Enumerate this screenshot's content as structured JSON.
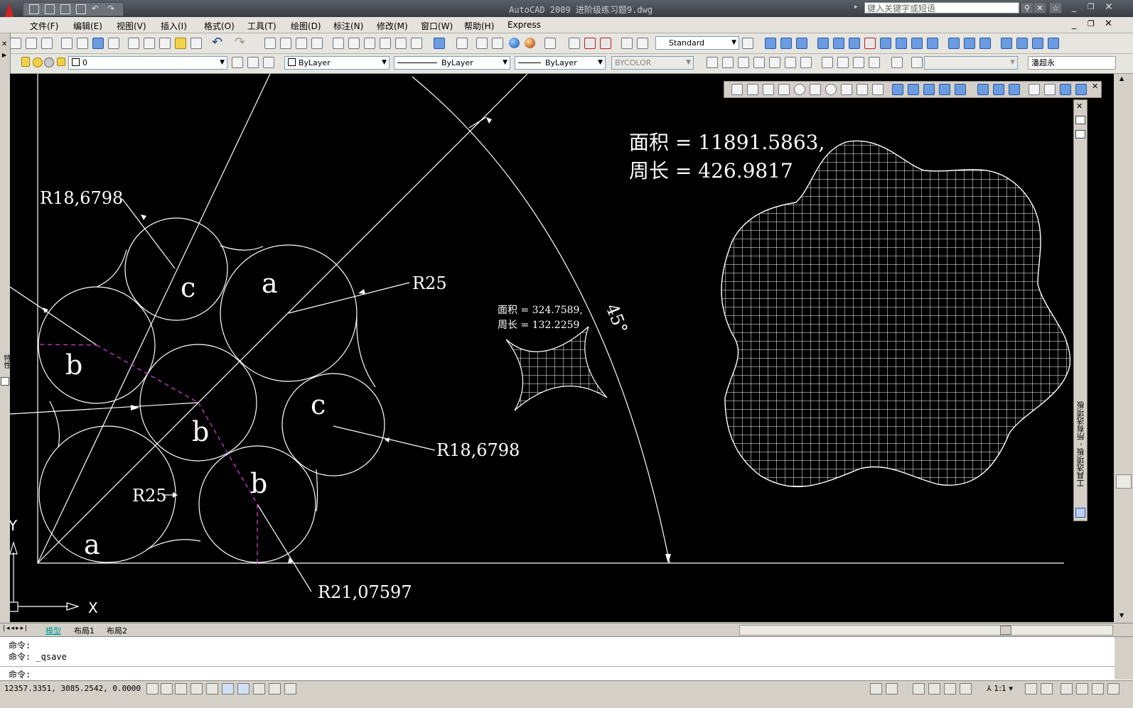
{
  "window": {
    "title": "AutoCAD 2009  进阶级练习题9.dwg",
    "search_placeholder": "键入关键字或短语"
  },
  "menu": [
    "文件(F)",
    "编辑(E)",
    "视图(V)",
    "插入(I)",
    "格式(O)",
    "工具(T)",
    "绘图(D)",
    "标注(N)",
    "修改(M)",
    "窗口(W)",
    "帮助(H)",
    "Express"
  ],
  "toolbar": {
    "text_style": "Standard",
    "layer_name": "0",
    "color": "ByLayer",
    "linetype": "ByLayer",
    "lineweight": "ByLayer",
    "plot_style": "BYCOLOR",
    "user_field": "潘超永"
  },
  "palette": {
    "side_label": "工具选项板 - 所有选项板",
    "left_tab_label": "特性"
  },
  "drawing": {
    "labels": {
      "a": "a",
      "b": "b",
      "c": "c"
    },
    "dim_r18_top": "R18,6798",
    "dim_r25_right": "R25",
    "dim_r18_right": "R18,6798",
    "dim_r25_left": "R25",
    "dim_r21": "R21,07597",
    "angle": "45°",
    "small_area": "面积 = 324.7589,",
    "small_perimeter": "周长 = 132.2259",
    "big_area": "面积 = 11891.5863,",
    "big_perimeter": "周长 = 426.9817",
    "ucs_x": "X",
    "ucs_y": "Y"
  },
  "tabs": [
    "模型",
    "布局1",
    "布局2"
  ],
  "command": {
    "line1": "命令:",
    "line2": "命令: _qsave",
    "prompt": "命令:"
  },
  "status": {
    "coords": "12357.3351, 3085.2542, 0.0000",
    "scale": "1:1"
  },
  "colors": {
    "canvas": "#000000",
    "lines": "#ffffff",
    "dashed": "#d23cd2",
    "active_tab": "#00a0a0"
  }
}
